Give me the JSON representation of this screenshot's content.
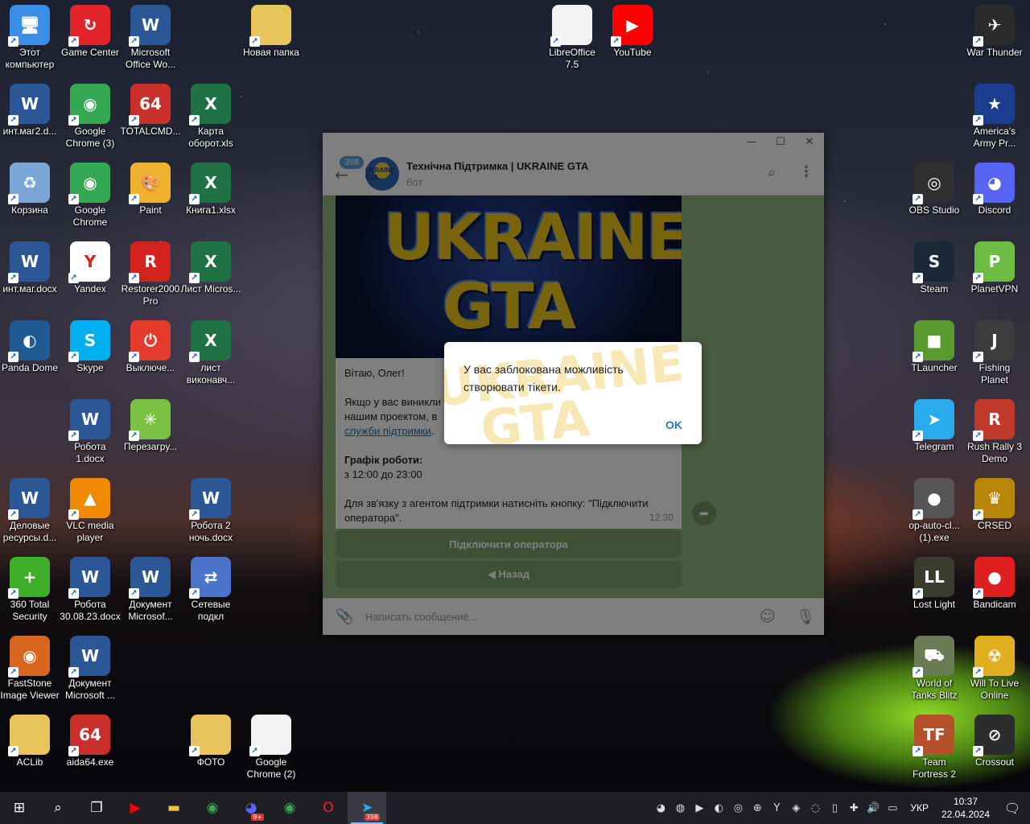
{
  "desktop": {
    "icons": [
      {
        "label": "Этот компьютер",
        "glyph": "🖥",
        "color": "#3a8ee6"
      },
      {
        "label": "Game Center",
        "glyph": "↻",
        "color": "#e2252b"
      },
      {
        "label": "Microsoft Office Wo...",
        "glyph": "W",
        "color": "#2b5797"
      },
      {
        "label": "Новая папка",
        "glyph": "",
        "color": "#e8c45a"
      },
      {
        "label": "LibreOffice 7.5",
        "glyph": "",
        "color": "#f2f2f2"
      },
      {
        "label": "YouTube",
        "glyph": "▶",
        "color": "#ff0000"
      },
      {
        "label": "War Thunder",
        "glyph": "✈",
        "color": "#2b2b2b"
      },
      {
        "label": "инт.маг2.d...",
        "glyph": "W",
        "color": "#2b5797"
      },
      {
        "label": "Google Chrome (3)",
        "glyph": "◉",
        "color": "#34a853"
      },
      {
        "label": "TOTALCMD...",
        "glyph": "64",
        "color": "#c9302c"
      },
      {
        "label": "Карта оборот.xls",
        "glyph": "X",
        "color": "#1f7244"
      },
      {
        "label": "America's Army Pr...",
        "glyph": "★",
        "color": "#1b3d8f"
      },
      {
        "label": "Корзина",
        "glyph": "♻",
        "color": "#7aa7d8"
      },
      {
        "label": "Google Chrome",
        "glyph": "◉",
        "color": "#34a853"
      },
      {
        "label": "Paint",
        "glyph": "🎨",
        "color": "#f0b030"
      },
      {
        "label": "Книга1.xlsx",
        "glyph": "X",
        "color": "#1f7244"
      },
      {
        "label": "OBS Studio",
        "glyph": "◎",
        "color": "#302e31"
      },
      {
        "label": "Discord",
        "glyph": "◕",
        "color": "#5865f2"
      },
      {
        "label": "инт.маг.docx",
        "glyph": "W",
        "color": "#2b5797"
      },
      {
        "label": "Yandex",
        "glyph": "Y",
        "color": "#ffffff"
      },
      {
        "label": "Restorer2000 Pro",
        "glyph": "R",
        "color": "#d4231f"
      },
      {
        "label": "Лист Micros...",
        "glyph": "X",
        "color": "#1f7244"
      },
      {
        "label": "Steam",
        "glyph": "S",
        "color": "#1b2838"
      },
      {
        "label": "PlanetVPN",
        "glyph": "P",
        "color": "#6dbd45"
      },
      {
        "label": "Panda Dome",
        "glyph": "◐",
        "color": "#1f5a94"
      },
      {
        "label": "Skype",
        "glyph": "S",
        "color": "#00aff0"
      },
      {
        "label": "Выключе...",
        "glyph": "⏻",
        "color": "#e53b2c"
      },
      {
        "label": "лист виконавч...",
        "glyph": "X",
        "color": "#1f7244"
      },
      {
        "label": "TLauncher",
        "glyph": "■",
        "color": "#5a9b2f"
      },
      {
        "label": "Fishing Planet",
        "glyph": "J",
        "color": "#3c3c3c"
      },
      {
        "label": "Робота 1.docx",
        "glyph": "W",
        "color": "#2b5797"
      },
      {
        "label": "Перезагру...",
        "glyph": "✳",
        "color": "#7bc143"
      },
      {
        "label": "Telegram",
        "glyph": "➤",
        "color": "#2aabee"
      },
      {
        "label": "Rush Rally 3 Demo",
        "glyph": "R",
        "color": "#c0392b"
      },
      {
        "label": "Деловые ресурсы.d...",
        "glyph": "W",
        "color": "#2b5797"
      },
      {
        "label": "VLC media player",
        "glyph": "▲",
        "color": "#f08a00"
      },
      {
        "label": "Робота 2 ночь.docx",
        "glyph": "W",
        "color": "#2b5797"
      },
      {
        "label": "op-auto-cl... (1).exe",
        "glyph": "●",
        "color": "#555555"
      },
      {
        "label": "CRSED",
        "glyph": "♛",
        "color": "#b8860b"
      },
      {
        "label": "360 Total Security",
        "glyph": "+",
        "color": "#3fae29"
      },
      {
        "label": "Робота 30.08.23.docx",
        "glyph": "W",
        "color": "#2b5797"
      },
      {
        "label": "Документ Microsof...",
        "glyph": "W",
        "color": "#2b5797"
      },
      {
        "label": "Сетевые подкл",
        "glyph": "⇄",
        "color": "#4a73c9"
      },
      {
        "label": "Lost Light",
        "glyph": "LL",
        "color": "#3b3b2e"
      },
      {
        "label": "Bandicam",
        "glyph": "●",
        "color": "#e02020"
      },
      {
        "label": "FastStone Image Viewer",
        "glyph": "◉",
        "color": "#d9661e"
      },
      {
        "label": "Документ Microsoft ...",
        "glyph": "W",
        "color": "#2b5797"
      },
      {
        "label": "World of Tanks Blitz",
        "glyph": "⛟",
        "color": "#6b7b56"
      },
      {
        "label": "Will To Live Online",
        "glyph": "☢",
        "color": "#e0b020"
      },
      {
        "label": "ACLib",
        "glyph": "",
        "color": "#e8c45a"
      },
      {
        "label": "aida64.exe",
        "glyph": "64",
        "color": "#c9302c"
      },
      {
        "label": "ФОТО",
        "glyph": "",
        "color": "#e8c45a"
      },
      {
        "label": "Google Chrome (2)",
        "glyph": "",
        "color": "#f2f2f2"
      },
      {
        "label": "Team Fortress 2",
        "glyph": "TF",
        "color": "#b5502a"
      },
      {
        "label": "Crossout",
        "glyph": "⊘",
        "color": "#2c2c2c"
      }
    ]
  },
  "telegram": {
    "unread_count": "398",
    "chat_title": "Технічна Підтримка | UKRAINE GTA",
    "chat_subtitle": "бот",
    "media_logo": "UKRAINE GTA",
    "avatar_text": "UKRAINE GTA",
    "message": {
      "greeting": "Вітаю, Олег!",
      "p2_start": "Якщо у вас виникли",
      "p2_mid": "нашим проектом, в",
      "link": "служби підтримки",
      "p2_end": ".",
      "schedule_title": "Графік роботи:",
      "schedule_time": "з 12:00 до 23:00",
      "agent_text": "Для зв'язку з агентом підтримки натисніть кнопку: \"Підключити оператора\".",
      "time": "12:30"
    },
    "buttons": {
      "connect": "Підключити оператора",
      "back": "◀ Назад"
    },
    "input_placeholder": "Написать сообщение..."
  },
  "dialog": {
    "text": "У вас заблокована можливість створювати тікети.",
    "ok": "OK",
    "watermark": "UKRAINE GTA"
  },
  "taskbar": {
    "items": [
      {
        "name": "start-button",
        "glyph": "⊞",
        "color": "#ffffff"
      },
      {
        "name": "search-button",
        "glyph": "⌕",
        "color": "#ffffff"
      },
      {
        "name": "task-view-button",
        "glyph": "❐",
        "color": "#ffffff"
      },
      {
        "name": "youtube-taskbar",
        "glyph": "▶",
        "color": "#ff0000"
      },
      {
        "name": "explorer-taskbar",
        "glyph": "▬",
        "color": "#f0c040"
      },
      {
        "name": "chrome-taskbar",
        "glyph": "◉",
        "color": "#34a853"
      },
      {
        "name": "discord-taskbar",
        "glyph": "◕",
        "color": "#5865f2"
      },
      {
        "name": "chrome2-taskbar",
        "glyph": "◉",
        "color": "#34a853"
      },
      {
        "name": "opera-taskbar",
        "glyph": "O",
        "color": "#ff1b2d"
      },
      {
        "name": "telegram-taskbar",
        "glyph": "➤",
        "color": "#2aabee"
      }
    ],
    "telegram_badge": "398",
    "discord_badge": "9+",
    "language": "УКР",
    "time": "10:37",
    "date": "22.04.2024"
  }
}
